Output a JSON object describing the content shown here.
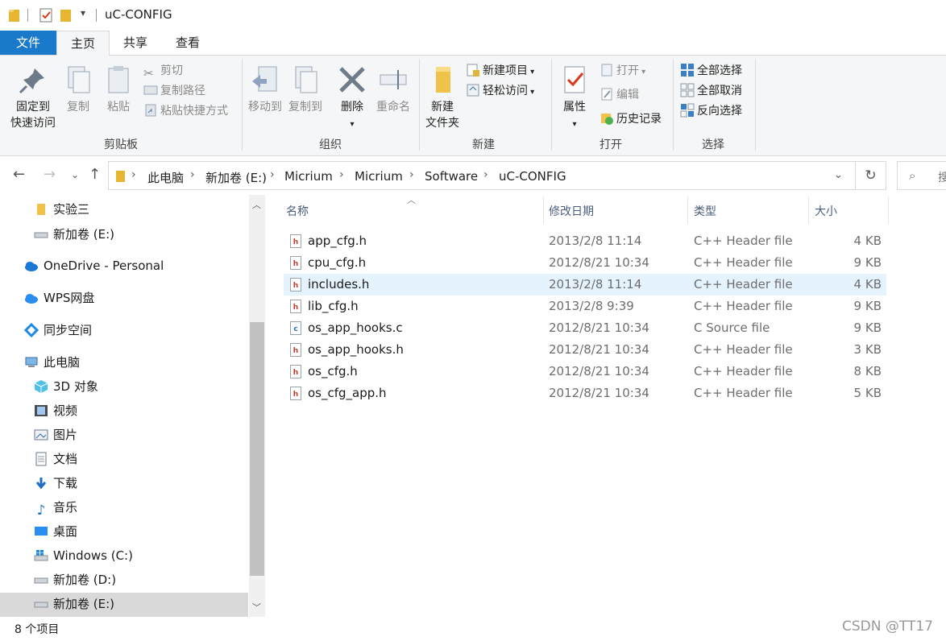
{
  "window": {
    "title": "uC-CONFIG"
  },
  "ribbon_tabs": [
    {
      "label": "文件"
    },
    {
      "label": "主页"
    },
    {
      "label": "共享"
    },
    {
      "label": "查看"
    }
  ],
  "ribbon": {
    "clipboard": {
      "pin_line1": "固定到",
      "pin_line2": "快速访问",
      "copy": "复制",
      "paste": "粘贴",
      "cut": "剪切",
      "copy_path": "复制路径",
      "paste_shortcut": "粘贴快捷方式",
      "label": "剪贴板"
    },
    "organize": {
      "move_to": "移动到",
      "copy_to": "复制到",
      "delete": "删除",
      "rename": "重命名",
      "label": "组织"
    },
    "new": {
      "new_folder_line1": "新建",
      "new_folder_line2": "文件夹",
      "new_item": "新建项目",
      "easy_access": "轻松访问",
      "label": "新建"
    },
    "open": {
      "properties": "属性",
      "open": "打开",
      "edit": "编辑",
      "history": "历史记录",
      "label": "打开"
    },
    "select": {
      "select_all": "全部选择",
      "select_none": "全部取消",
      "invert": "反向选择",
      "label": "选择"
    }
  },
  "breadcrumb": [
    "此电脑",
    "新加卷 (E:)",
    "Micrium",
    "Micrium",
    "Software",
    "uC-CONFIG"
  ],
  "search": {
    "placeholder": "搜"
  },
  "nav_pane": [
    {
      "label": "实验三"
    },
    {
      "label": "新加卷 (E:)"
    },
    {
      "label": "OneDrive - Personal"
    },
    {
      "label": "WPS网盘"
    },
    {
      "label": "同步空间"
    },
    {
      "label": "此电脑"
    },
    {
      "label": "3D 对象"
    },
    {
      "label": "视频"
    },
    {
      "label": "图片"
    },
    {
      "label": "文档"
    },
    {
      "label": "下载"
    },
    {
      "label": "音乐"
    },
    {
      "label": "桌面"
    },
    {
      "label": "Windows (C:)"
    },
    {
      "label": "新加卷 (D:)"
    },
    {
      "label": "新加卷 (E:)"
    }
  ],
  "columns": {
    "name": "名称",
    "date": "修改日期",
    "type": "类型",
    "size": "大小"
  },
  "files": [
    {
      "name": "app_cfg.h",
      "date": "2013/2/8 11:14",
      "type": "C++ Header file",
      "size": "4 KB",
      "icon": "h"
    },
    {
      "name": "cpu_cfg.h",
      "date": "2012/8/21 10:34",
      "type": "C++ Header file",
      "size": "9 KB",
      "icon": "h"
    },
    {
      "name": "includes.h",
      "date": "2013/2/8 11:14",
      "type": "C++ Header file",
      "size": "4 KB",
      "icon": "h"
    },
    {
      "name": "lib_cfg.h",
      "date": "2013/2/8 9:39",
      "type": "C++ Header file",
      "size": "9 KB",
      "icon": "h"
    },
    {
      "name": "os_app_hooks.c",
      "date": "2012/8/21 10:34",
      "type": "C Source file",
      "size": "9 KB",
      "icon": "c"
    },
    {
      "name": "os_app_hooks.h",
      "date": "2012/8/21 10:34",
      "type": "C++ Header file",
      "size": "3 KB",
      "icon": "h"
    },
    {
      "name": "os_cfg.h",
      "date": "2012/8/21 10:34",
      "type": "C++ Header file",
      "size": "8 KB",
      "icon": "h"
    },
    {
      "name": "os_cfg_app.h",
      "date": "2012/8/21 10:34",
      "type": "C++ Header file",
      "size": "5 KB",
      "icon": "h"
    }
  ],
  "status": {
    "count": "8 个项目"
  },
  "watermark": "CSDN @TT17",
  "colors": {
    "accent": "#1979ca",
    "selected_row": "#e5f3ff",
    "header_icon_red": "#c0392b",
    "source_icon_blue": "#1e6fc1"
  }
}
